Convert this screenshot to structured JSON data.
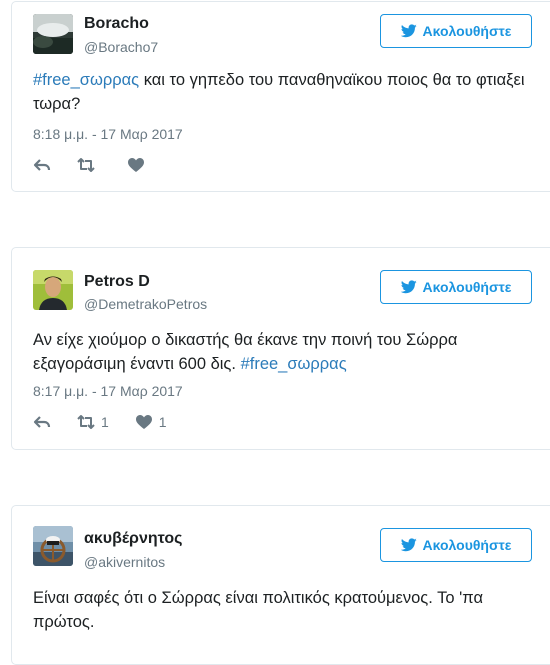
{
  "tweets": [
    {
      "name": "Boracho",
      "handle": "@Boracho7",
      "follow_label": "Ακολουθήστε",
      "hashtag": "#free_σωρρας",
      "text_after": " και το γηπεδο του παναθηναϊκου ποιος θα το φτιαξει τωρα?",
      "timestamp": "8:18 μ.μ. - 17 Μαρ 2017",
      "retweets": "",
      "likes": ""
    },
    {
      "name": "Petros D",
      "handle": "@DemetrakoPetros",
      "follow_label": "Ακολουθήστε",
      "text_before": "Αν είχε χιούμορ ο δικαστής θα έκανε την ποινή του Σώρρα εξαγοράσιμη έναντι 600 δις. ",
      "hashtag": "#free_σωρρας",
      "timestamp": "8:17 μ.μ. - 17 Μαρ 2017",
      "retweets": "1",
      "likes": "1"
    },
    {
      "name": "ακυβέρνητος",
      "handle": "@akivernitos",
      "follow_label": "Ακολουθήστε",
      "text": "Είναι σαφές ότι ο Σώρρας είναι πολιτικός κρατούμενος. Το 'πα πρώτος."
    }
  ],
  "icons": {
    "bird": "twitter-bird-icon",
    "reply": "reply-icon",
    "retweet": "retweet-icon",
    "like": "heart-icon"
  },
  "colors": {
    "accent": "#1b95e0",
    "hashtag": "#2b7bb9",
    "muted": "#697882",
    "border": "#e1e8ed"
  }
}
